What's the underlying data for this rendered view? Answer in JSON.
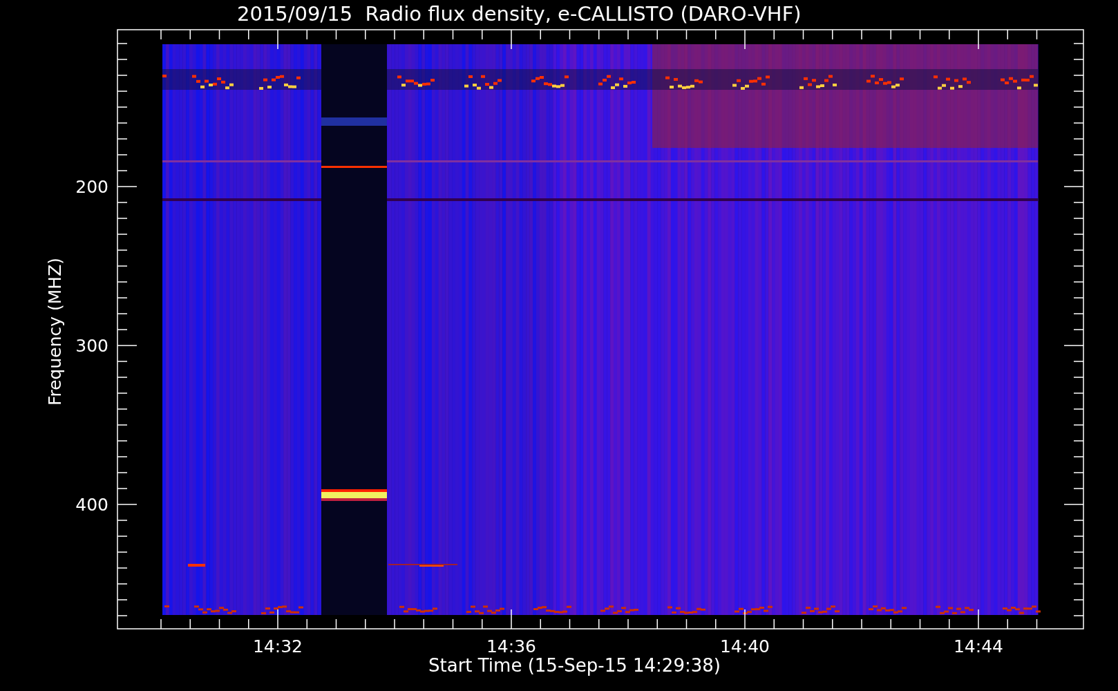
{
  "title": "2015/09/15  Radio flux density, e-CALLISTO (DARO-VHF)",
  "y_axis": {
    "label": "Frequency (MHZ)",
    "ticks": [
      "200",
      "300",
      "400"
    ]
  },
  "x_axis": {
    "label": "Start Time (15-Sep-15 14:29:38)",
    "ticks": [
      "14:32",
      "14:36",
      "14:40",
      "14:44"
    ]
  }
}
